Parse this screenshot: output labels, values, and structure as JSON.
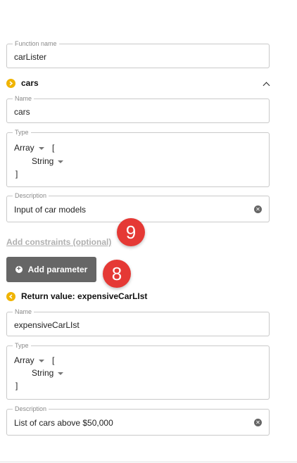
{
  "function_name": {
    "label": "Function name",
    "value": "carLister"
  },
  "parameter": {
    "title": "cars",
    "name": {
      "label": "Name",
      "value": "cars"
    },
    "type": {
      "label": "Type",
      "kind": "Array",
      "open": "[",
      "item": "String",
      "close": "]"
    },
    "description": {
      "label": "Description",
      "value": "Input of car models"
    }
  },
  "add_constraints_label": "Add constraints (optional)",
  "add_parameter_label": "Add parameter",
  "return_value": {
    "title": "Return value: expensiveCarLIst",
    "name": {
      "label": "Name",
      "value": "expensiveCarLIst"
    },
    "type": {
      "label": "Type",
      "kind": "Array",
      "open": "[",
      "item": "String",
      "close": "]"
    },
    "description": {
      "label": "Description",
      "value": "List of cars above $50,000"
    }
  },
  "markers": {
    "constraints": "9",
    "add_parameter": "8"
  },
  "colors": {
    "accent_dot": "#f0b400",
    "marker": "#e53935",
    "button": "#666666"
  },
  "icons": {
    "section_expand": "chevron-right-icon",
    "section_collapse": "chevron-left-icon",
    "collapse": "chevron-up-icon",
    "clear": "close-circle-icon",
    "add": "plus-circle-icon",
    "dropdown": "caret-down-icon"
  }
}
